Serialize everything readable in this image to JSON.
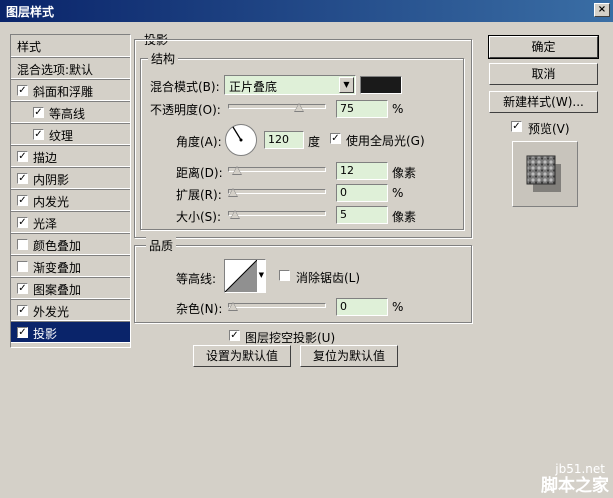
{
  "window": {
    "title": "图层样式",
    "close_label": "×"
  },
  "left_panel": {
    "header": "样式",
    "blend_options": "混合选项:默认",
    "items": [
      {
        "label": "斜面和浮雕",
        "checked": true
      },
      {
        "label": "等高线",
        "checked": true
      },
      {
        "label": "纹理",
        "checked": true
      },
      {
        "label": "描边",
        "checked": true
      },
      {
        "label": "内阴影",
        "checked": true
      },
      {
        "label": "内发光",
        "checked": true
      },
      {
        "label": "光泽",
        "checked": true
      },
      {
        "label": "颜色叠加",
        "checked": false
      },
      {
        "label": "渐变叠加",
        "checked": false
      },
      {
        "label": "图案叠加",
        "checked": true
      },
      {
        "label": "外发光",
        "checked": true
      },
      {
        "label": "投影",
        "checked": true
      }
    ]
  },
  "drop_shadow": {
    "title": "投影",
    "structure": {
      "title": "结构",
      "blend_mode_label": "混合模式(B):",
      "blend_mode_value": "正片叠底",
      "shadow_color": "#1a1a1a",
      "opacity_label": "不透明度(O):",
      "opacity_value": "75",
      "opacity_unit": "%",
      "opacity_level": 75,
      "angle_label": "角度(A):",
      "angle_value": "120",
      "angle_unit": "度",
      "global_light_label": "使用全局光(G)",
      "global_light_checked": true,
      "distance_label": "距离(D):",
      "distance_value": "12",
      "distance_unit": "像素",
      "distance_level": 12,
      "spread_label": "扩展(R):",
      "spread_value": "0",
      "spread_unit": "%",
      "spread_level": 0,
      "size_label": "大小(S):",
      "size_value": "5",
      "size_unit": "像素",
      "size_level": 5
    },
    "quality": {
      "title": "品质",
      "contour_label": "等高线:",
      "antialias_label": "消除锯齿(L)",
      "antialias_checked": false,
      "noise_label": "杂色(N):",
      "noise_value": "0",
      "noise_unit": "%",
      "noise_level": 0
    },
    "knockout_label": "图层挖空投影(U)",
    "knockout_checked": true,
    "make_default_label": "设置为默认值",
    "reset_default_label": "复位为默认值"
  },
  "buttons": {
    "ok": "确定",
    "cancel": "取消",
    "new_style": "新建样式(W)...",
    "preview_label": "预览(V)",
    "preview_checked": true
  },
  "watermark": {
    "site": "jb51.net",
    "brand": "脚本之家"
  }
}
